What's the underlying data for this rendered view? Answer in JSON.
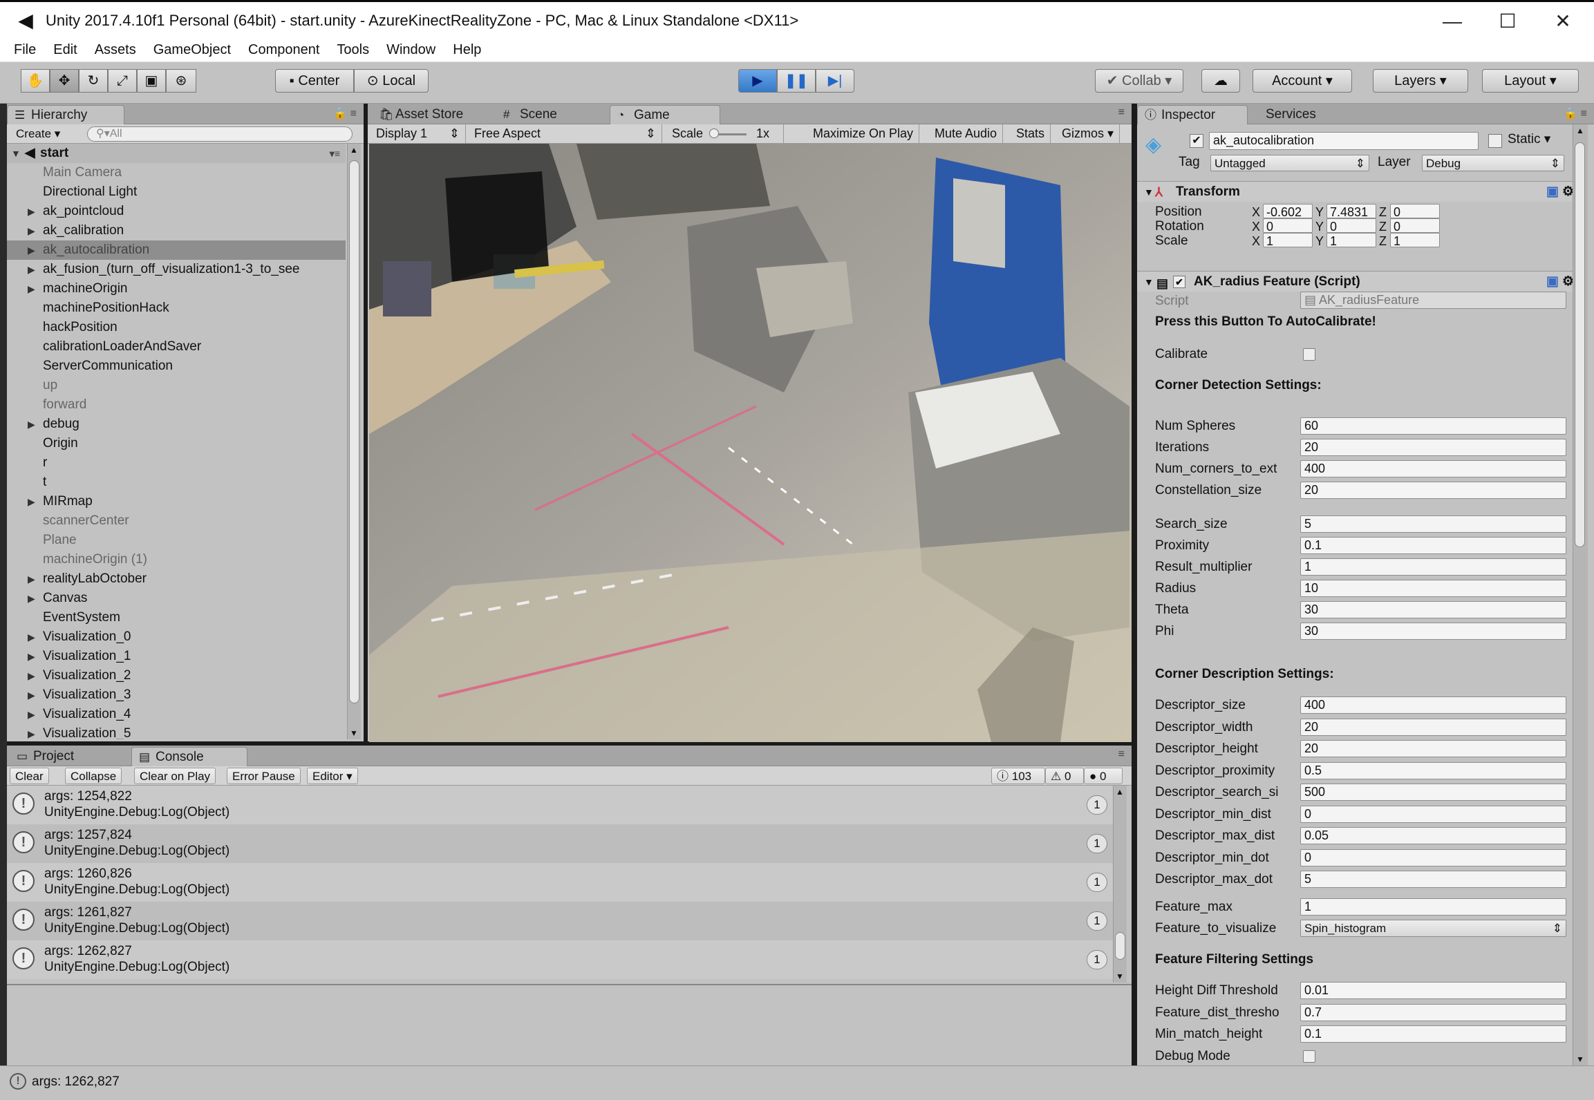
{
  "window": {
    "title": "Unity 2017.4.10f1 Personal (64bit) - start.unity - AzureKinectRealityZone - PC, Mac & Linux Standalone <DX11>",
    "minimize": "—",
    "maximize": "☐",
    "close": "✕"
  },
  "menu": [
    "File",
    "Edit",
    "Assets",
    "GameObject",
    "Component",
    "Tools",
    "Window",
    "Help"
  ],
  "toolbar": {
    "pivot_center": "Center",
    "pivot_local": "Local",
    "collab": "Collab ▾",
    "account": "Account",
    "layers": "Layers",
    "layout": "Layout"
  },
  "hierarchy": {
    "tab": "Hierarchy",
    "create": "Create",
    "search_placeholder": "All",
    "scene": "start",
    "items": [
      {
        "label": "Main Camera",
        "state": "dim",
        "expand": false
      },
      {
        "label": "Directional Light",
        "state": "normal",
        "expand": false
      },
      {
        "label": "ak_pointcloud",
        "state": "normal",
        "expand": true
      },
      {
        "label": "ak_calibration",
        "state": "normal",
        "expand": true
      },
      {
        "label": "ak_autocalibration",
        "state": "selected",
        "expand": true
      },
      {
        "label": "ak_fusion_(turn_off_visualization1-3_to_see",
        "state": "normal",
        "expand": true
      },
      {
        "label": "machineOrigin",
        "state": "normal",
        "expand": true
      },
      {
        "label": "machinePositionHack",
        "state": "normal",
        "expand": false
      },
      {
        "label": "hackPosition",
        "state": "normal",
        "expand": false
      },
      {
        "label": "calibrationLoaderAndSaver",
        "state": "normal",
        "expand": false
      },
      {
        "label": "ServerCommunication",
        "state": "normal",
        "expand": false
      },
      {
        "label": "up",
        "state": "dim",
        "expand": false
      },
      {
        "label": "forward",
        "state": "dim",
        "expand": false
      },
      {
        "label": "debug",
        "state": "normal",
        "expand": true
      },
      {
        "label": "Origin",
        "state": "normal",
        "expand": false
      },
      {
        "label": "r",
        "state": "normal",
        "expand": false
      },
      {
        "label": "t",
        "state": "normal",
        "expand": false
      },
      {
        "label": "MIRmap",
        "state": "normal",
        "expand": true
      },
      {
        "label": "scannerCenter",
        "state": "dim",
        "expand": false
      },
      {
        "label": "Plane",
        "state": "dim",
        "expand": false
      },
      {
        "label": "machineOrigin (1)",
        "state": "dim",
        "expand": false
      },
      {
        "label": "realityLabOctober",
        "state": "normal",
        "expand": true
      },
      {
        "label": "Canvas",
        "state": "normal",
        "expand": true
      },
      {
        "label": "EventSystem",
        "state": "normal",
        "expand": false
      },
      {
        "label": "Visualization_0",
        "state": "normal",
        "expand": true
      },
      {
        "label": "Visualization_1",
        "state": "normal",
        "expand": true
      },
      {
        "label": "Visualization_2",
        "state": "normal",
        "expand": true
      },
      {
        "label": "Visualization_3",
        "state": "normal",
        "expand": true
      },
      {
        "label": "Visualization_4",
        "state": "normal",
        "expand": true
      },
      {
        "label": "Visualization_5",
        "state": "normal",
        "expand": true
      }
    ]
  },
  "center_tabs": {
    "asset_store": "Asset Store",
    "scene": "Scene",
    "game": "Game"
  },
  "game_bar": {
    "display": "Display 1",
    "aspect": "Free Aspect",
    "scale_label": "Scale",
    "scale_value": "1x",
    "maximize": "Maximize On Play",
    "mute": "Mute Audio",
    "stats": "Stats",
    "gizmos": "Gizmos"
  },
  "inspector": {
    "tab": "Inspector",
    "services": "Services",
    "object_name": "ak_autocalibration",
    "static_label": "Static",
    "tag_label": "Tag",
    "tag_value": "Untagged",
    "layer_label": "Layer",
    "layer_value": "Debug",
    "transform": {
      "title": "Transform",
      "rows": [
        {
          "label": "Position",
          "x": "-0.602",
          "y": "7.4831",
          "z": "0"
        },
        {
          "label": "Rotation",
          "x": "0",
          "y": "0",
          "z": "0"
        },
        {
          "label": "Scale",
          "x": "1",
          "y": "1",
          "z": "1"
        }
      ]
    },
    "script_component": {
      "title": "AK_radius Feature (Script)",
      "script_label": "Script",
      "script_value": "AK_radiusFeature",
      "button_header": "Press this Button To AutoCalibrate!",
      "calibrate_label": "Calibrate",
      "section1": "Corner Detection Settings:",
      "fields1": [
        {
          "label": "Num Spheres",
          "value": "60"
        },
        {
          "label": "Iterations",
          "value": "20"
        },
        {
          "label": "Num_corners_to_ext",
          "value": "400"
        },
        {
          "label": "Constellation_size",
          "value": "20"
        }
      ],
      "fields1b": [
        {
          "label": "Search_size",
          "value": "5"
        },
        {
          "label": "Proximity",
          "value": "0.1"
        },
        {
          "label": "Result_multiplier",
          "value": "1"
        },
        {
          "label": "Radius",
          "value": "10"
        },
        {
          "label": "Theta",
          "value": "30"
        },
        {
          "label": "Phi",
          "value": "30"
        }
      ],
      "section2": "Corner Description Settings:",
      "fields2": [
        {
          "label": "Descriptor_size",
          "value": "400"
        },
        {
          "label": "Descriptor_width",
          "value": "20"
        },
        {
          "label": "Descriptor_height",
          "value": "20"
        },
        {
          "label": "Descriptor_proximity",
          "value": "0.5"
        },
        {
          "label": "Descriptor_search_si",
          "value": "500"
        },
        {
          "label": "Descriptor_min_dist",
          "value": "0"
        },
        {
          "label": "Descriptor_max_dist",
          "value": "0.05"
        },
        {
          "label": "Descriptor_min_dot",
          "value": "0"
        },
        {
          "label": "Descriptor_max_dot",
          "value": "5"
        }
      ],
      "feature_max_label": "Feature_max",
      "feature_max_value": "1",
      "feature_vis_label": "Feature_to_visualize",
      "feature_vis_value": "Spin_histogram",
      "section3": "Feature Filtering Settings",
      "fields3": [
        {
          "label": "Height Diff Threshold",
          "value": "0.01"
        },
        {
          "label": "Feature_dist_thresho",
          "value": "0.7"
        },
        {
          "label": "Min_match_height",
          "value": "0.1"
        }
      ],
      "debug_label": "Debug Mode"
    }
  },
  "console": {
    "project_tab": "Project",
    "console_tab": "Console",
    "clear": "Clear",
    "collapse": "Collapse",
    "clear_on_play": "Clear on Play",
    "error_pause": "Error Pause",
    "editor": "Editor",
    "count_log": "103",
    "count_warn": "0",
    "count_err": "0",
    "entries": [
      {
        "line1": "args: 1254,822",
        "line2": "UnityEngine.Debug:Log(Object)",
        "count": "1"
      },
      {
        "line1": "args: 1257,824",
        "line2": "UnityEngine.Debug:Log(Object)",
        "count": "1"
      },
      {
        "line1": "args: 1260,826",
        "line2": "UnityEngine.Debug:Log(Object)",
        "count": "1"
      },
      {
        "line1": "args: 1261,827",
        "line2": "UnityEngine.Debug:Log(Object)",
        "count": "1"
      },
      {
        "line1": "args: 1262,827",
        "line2": "UnityEngine.Debug:Log(Object)",
        "count": "1"
      }
    ]
  },
  "status": {
    "text": "args: 1262,827"
  }
}
